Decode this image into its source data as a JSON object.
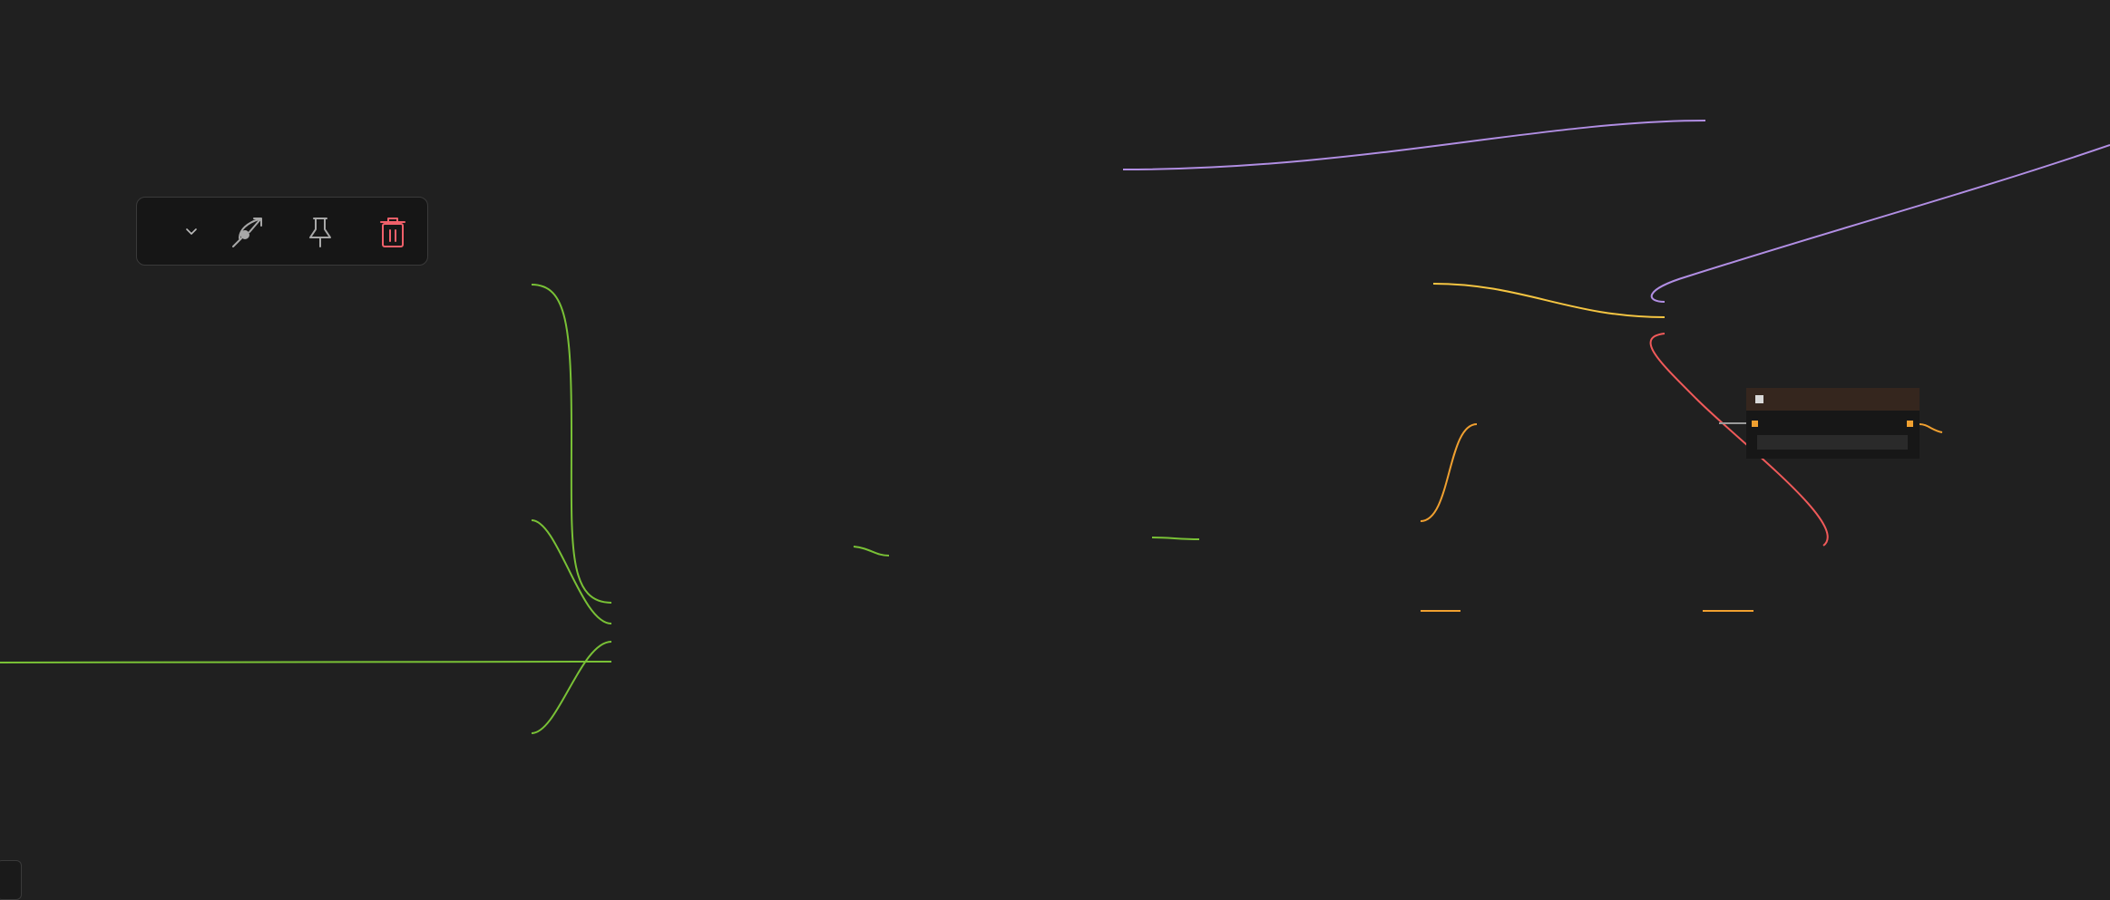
{
  "toolbar": {
    "buttons": [
      {
        "name": "collapse-toggle",
        "icon": "chevron-down-icon"
      },
      {
        "name": "bypass",
        "icon": "link-arrow-icon"
      },
      {
        "name": "pin",
        "icon": "pin-icon"
      },
      {
        "name": "delete",
        "icon": "trash-icon",
        "color": "#f0606a"
      }
    ]
  },
  "links": {
    "colors": {
      "green": "#79c136",
      "purple": "#b18ee3",
      "yellow": "#f5c542",
      "orange": "#f0a030",
      "red": "#f05a5a"
    }
  },
  "mini_node": {
    "header_color": "#35261e",
    "port_color": "#f0a030"
  }
}
